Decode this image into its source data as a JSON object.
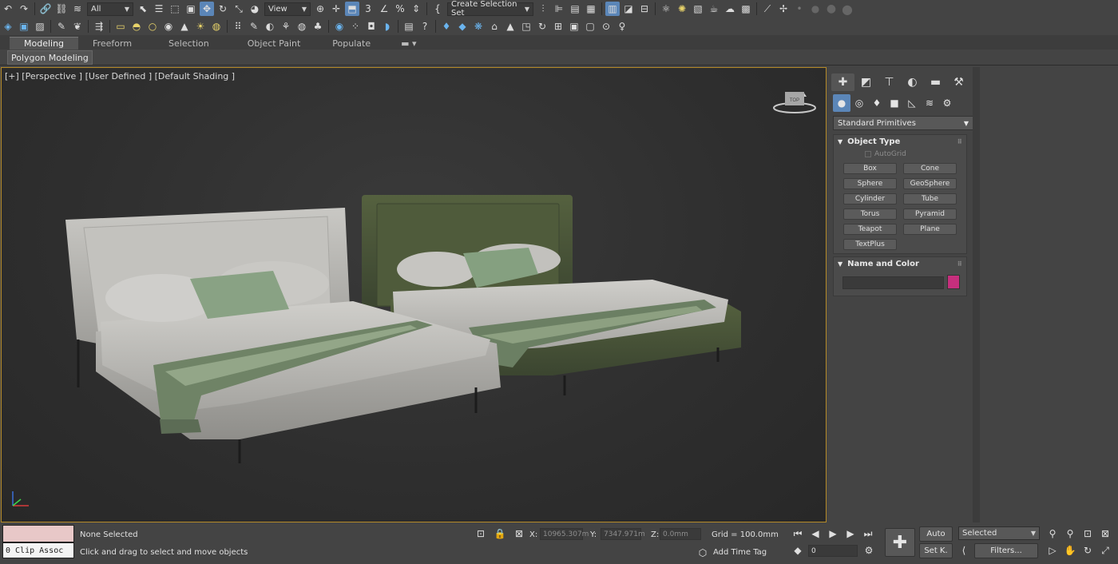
{
  "toolbar": {
    "selection_filter": "All",
    "ref_coord": "View",
    "named_selection": "Create Selection Set"
  },
  "ribbon": {
    "tabs": [
      "Modeling",
      "Freeform",
      "Selection",
      "Object Paint",
      "Populate"
    ],
    "active_tab": "Modeling",
    "panel_label": "Polygon Modeling"
  },
  "viewport": {
    "label": "[+] [Perspective ] [User Defined ] [Default Shading ]",
    "viewcube_label": "TOP"
  },
  "command_panel": {
    "category_dropdown": "Standard Primitives",
    "object_type": {
      "title": "Object Type",
      "autogrid_label": "AutoGrid",
      "buttons": [
        "Box",
        "Cone",
        "Sphere",
        "GeoSphere",
        "Cylinder",
        "Tube",
        "Torus",
        "Pyramid",
        "Teapot",
        "Plane",
        "TextPlus"
      ]
    },
    "name_color": {
      "title": "Name and Color",
      "swatch_color": "#c62f7d"
    }
  },
  "status": {
    "clip_label": "0 Clip Assoc",
    "selection_status": "None Selected",
    "prompt": "Click and drag to select and move objects",
    "x_label": "X:",
    "x_value": "10965.307m",
    "y_label": "Y:",
    "y_value": "7347.971m",
    "z_label": "Z:",
    "z_value": "0.0mm",
    "grid": "Grid = 100.0mm",
    "add_time_tag": "Add Time Tag",
    "frame_value": "0",
    "auto_key": "Auto",
    "set_key": "Set K.",
    "key_filter": "Selected",
    "filters": "Filters..."
  },
  "colors": {
    "accent": "#5b86b8",
    "viewport_border": "#b58a28",
    "grey_bed": "#b9b8b4",
    "green_bed": "#4a5638"
  }
}
